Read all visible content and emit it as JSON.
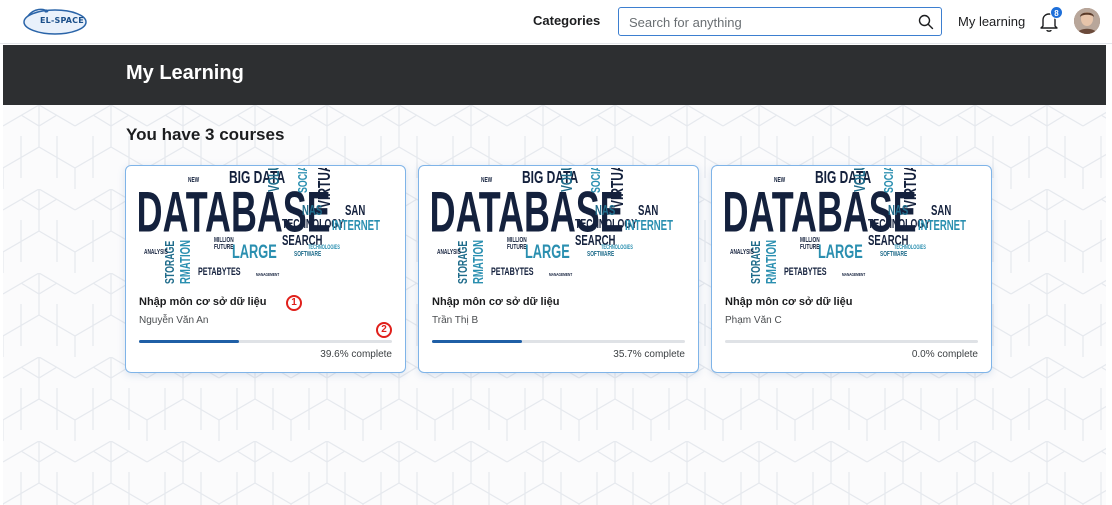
{
  "nav": {
    "logo_text": "EL-SPACE",
    "categories_label": "Categories",
    "search_placeholder": "Search for anything",
    "my_learning_label": "My learning",
    "notification_count": "8"
  },
  "header": {
    "title": "My Learning"
  },
  "main": {
    "course_count_text": "You have 3 courses"
  },
  "courses": [
    {
      "title": "Nhập môn cơ sở dữ liệu",
      "instructor": "Nguyễn Văn An",
      "progress": 39.6,
      "progress_text": "39.6% complete"
    },
    {
      "title": "Nhập môn cơ sở dữ liệu",
      "instructor": "Trần Thị B",
      "progress": 35.7,
      "progress_text": "35.7% complete"
    },
    {
      "title": "Nhập môn cơ sở dữ liệu",
      "instructor": "Phạm Văn C",
      "progress": 0.0,
      "progress_text": "0.0% complete"
    }
  ],
  "thumbnail_words": {
    "big": "DATABASE",
    "words": [
      "BIG DATA",
      "VOLUM",
      "SOCIAL",
      "VIRTUAL",
      "NAS",
      "SAN",
      "TECHNOLOGY",
      "INTERNET",
      "SEARCH",
      "LARGE",
      "STORAGE",
      "RMATION",
      "PETABYTES",
      "ANALYSIS",
      "SOFTWARE",
      "MANAGEMENT",
      "MILLION",
      "FUTURE",
      "NEW",
      "TECHNOLOGIES"
    ]
  },
  "annotations": [
    "1",
    "2"
  ],
  "colors": {
    "accent": "#1f5fa6",
    "band": "#2d2f31",
    "card_border": "#7fb4e8",
    "marker": "#e0201b"
  }
}
